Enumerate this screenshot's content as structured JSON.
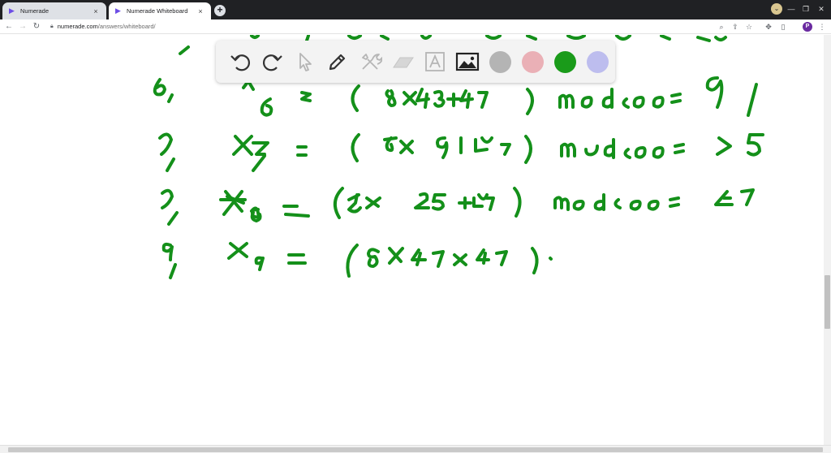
{
  "browser": {
    "tabs": [
      {
        "title": "Numerade",
        "active": false
      },
      {
        "title": "Numerade Whiteboard",
        "active": true
      }
    ],
    "new_tab_glyph": "+",
    "close_glyph": "×",
    "url_host": "numerade.com",
    "url_path": "/answers/whiteboard/",
    "profile_initial": "P"
  },
  "icons": {
    "back": "arrow-left-icon",
    "forward": "arrow-right-icon",
    "reload": "reload-icon",
    "lock": "lock-icon",
    "zoom": "zoom-icon",
    "share": "share-icon",
    "bookmark": "star-icon",
    "extensions": "puzzle-icon",
    "sidebar": "sidebar-icon",
    "menu": "kebab-menu-icon"
  },
  "whiteboard": {
    "tools": [
      {
        "name": "undo",
        "state": "enabled"
      },
      {
        "name": "redo",
        "state": "enabled"
      },
      {
        "name": "select",
        "state": "disabled"
      },
      {
        "name": "pen",
        "state": "enabled"
      },
      {
        "name": "tools",
        "state": "disabled"
      },
      {
        "name": "eraser",
        "state": "disabled"
      },
      {
        "name": "text",
        "state": "disabled"
      },
      {
        "name": "image",
        "state": "enabled"
      }
    ],
    "colors": [
      {
        "name": "gray",
        "hex": "#b4b4b4"
      },
      {
        "name": "pink",
        "hex": "#eab0b6"
      },
      {
        "name": "green",
        "hex": "#1a9b1a"
      },
      {
        "name": "lavender",
        "hex": "#bdbdee"
      }
    ],
    "selected_color": "green",
    "ink_color": "#14901a"
  }
}
